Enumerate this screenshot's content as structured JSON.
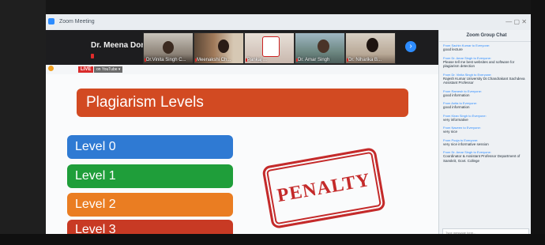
{
  "window": {
    "title": "Zoom Meeting"
  },
  "video_strip": {
    "host_name": "Dr. Meena Doni...",
    "participants": [
      {
        "name": "Dr.Vinita Singh C..."
      },
      {
        "name": "Meenakshi Ch..."
      },
      {
        "name": "Pankaj ..."
      },
      {
        "name": "Dr. Amar Singh"
      },
      {
        "name": "Dr. Niharika B..."
      }
    ],
    "next_label": "›"
  },
  "broadcast": {
    "live_label": "LIVE",
    "platform_label": "on YouTube ▾"
  },
  "slide": {
    "title": "Plagiarism Levels",
    "levels": [
      "Level 0",
      "Level 1",
      "Level 2",
      "Level 3"
    ],
    "stamp": "PENALTY"
  },
  "chat": {
    "title": "Zoom Group Chat",
    "messages": [
      {
        "from": "From Sachin Kumar to Everyone:",
        "text": "good lecture"
      },
      {
        "from": "From Dr. Amar Singh to Everyone:",
        "text": "Please tell me best websites and software for plagiarism detection"
      },
      {
        "from": "From Dr. Vinita Singh to Everyone:",
        "text": "Rajesh Kumar University Dr.Chandrakant Sachdeva Assistant Professor"
      },
      {
        "from": "From Ramesh to Everyone:",
        "text": "good information"
      },
      {
        "from": "From Anita to Everyone:",
        "text": "good information"
      },
      {
        "from": "From Kiran Singh to Everyone:",
        "text": "very informative"
      },
      {
        "from": "From Naveen to Everyone:",
        "text": "very nice"
      },
      {
        "from": "From Pooja to Everyone:",
        "text": "very nice informative session"
      },
      {
        "from": "From Dr. Amar Singh to Everyone:",
        "text": "Coordinator & Assistant Professor Department of Sanskrit, Govt. College"
      }
    ],
    "input_placeholder": "Type message here..."
  },
  "colors": {
    "title_bar": "#d24a22",
    "level0": "#2f7ad3",
    "level1": "#1f9e3a",
    "level2": "#ea7d22",
    "level3": "#c83a24",
    "stamp": "#c42a2a"
  }
}
